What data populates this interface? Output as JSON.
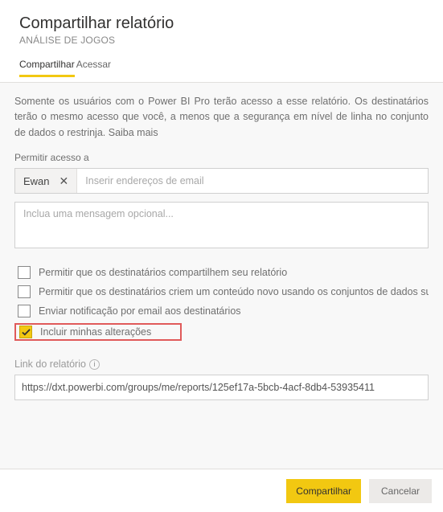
{
  "header": {
    "title": "Compartilhar relatório",
    "subtitle": "ANÁLISE DE JOGOS"
  },
  "tabs": {
    "share": "Compartilhar",
    "access": "Acessar"
  },
  "body": {
    "description": "Somente os usuários com o Power BI Pro terão acesso a esse relatório. Os destinatários terão o mesmo acesso que você, a menos que a segurança em nível de linha no conjunto de dados o restrinja. Saiba mais",
    "access_label": "Permitir acesso a",
    "chip_name": "Ewan",
    "email_placeholder": "Inserir endereços de email",
    "message_placeholder": "Inclua uma mensagem opcional...",
    "options": {
      "allow_reshare": "Permitir que os destinatários compartilhem seu relatório",
      "allow_build": "Permitir que os destinatários criem um conteúdo novo usando os conjuntos de dados subjacentes",
      "send_email": "Enviar notificação por email aos destinatários",
      "include_changes": "Incluir minhas alterações"
    },
    "link_label": "Link do relatório",
    "link_value": "https://dxt.powerbi.com/groups/me/reports/125ef17a-5bcb-4acf-8db4-53935411"
  },
  "footer": {
    "share": "Compartilhar",
    "cancel": "Cancelar"
  }
}
